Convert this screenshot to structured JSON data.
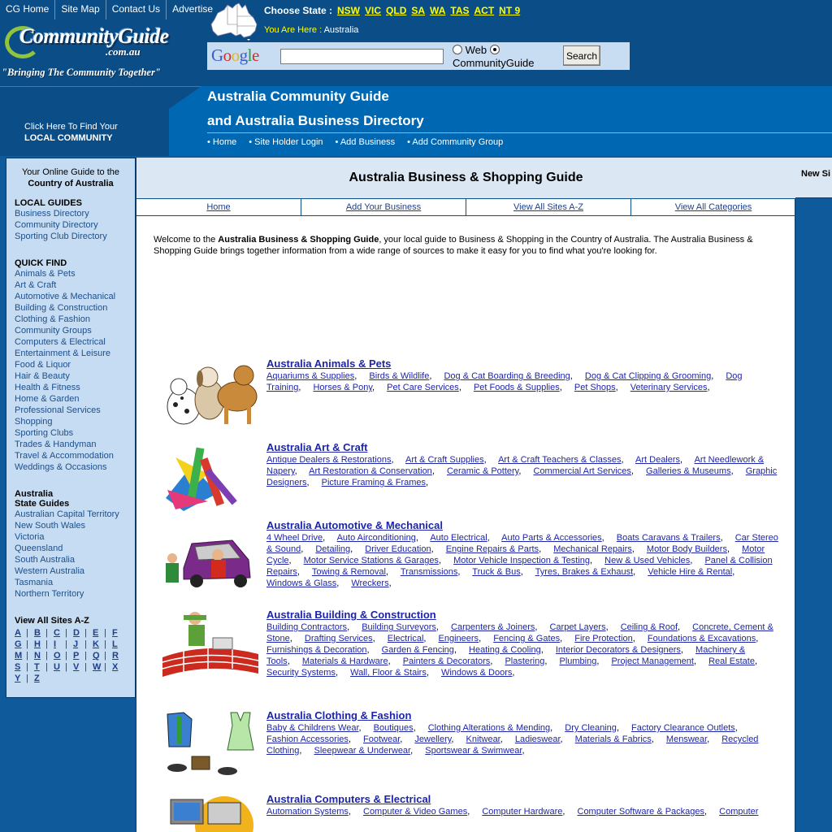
{
  "toplinks": [
    "CG Home",
    "Site Map",
    "Contact Us",
    "Advertise"
  ],
  "logo": {
    "line1": "CommunityGuide",
    "line2": ".com.au",
    "tagline": "\"Bringing The Community Together\""
  },
  "choose_state": {
    "label": "Choose State :",
    "states": [
      "NSW",
      "VIC",
      "QLD",
      "SA",
      "WA",
      "TAS",
      "ACT",
      "NT 9"
    ]
  },
  "you_are_here": {
    "label": "You Are Here :",
    "value": "Australia"
  },
  "search": {
    "logo": "Google",
    "query": "",
    "option_web": "Web",
    "option_site": "CommunityGuide",
    "button": "Search",
    "selected": "CommunityGuide"
  },
  "local_community": {
    "line1": "Click Here To Find Your",
    "line2": "LOCAL COMMUNITY"
  },
  "site_title": {
    "line1": "Australia Community Guide",
    "line2": "and Australia Business Directory"
  },
  "subnav": [
    "• Home",
    "• Site Holder Login",
    "• Add Business",
    "• Add Community Group"
  ],
  "sidebar": {
    "intro1": "Your Online Guide to the",
    "intro2": "Country of Australia",
    "local_guides_title": "LOCAL GUIDES",
    "local_guides": [
      "Business Directory",
      "Community Directory",
      "Sporting Club Directory"
    ],
    "quick_find_title": "QUICK FIND",
    "quick_find": [
      "Animals & Pets",
      "Art & Craft",
      "Automotive & Mechanical",
      "Building & Construction",
      "Clothing & Fashion",
      "Community Groups",
      "Computers & Electrical",
      "Entertainment & Leisure",
      "Food & Liquor",
      "Hair & Beauty",
      "Health & Fitness",
      "Home & Garden",
      "Professional Services",
      "Shopping",
      "Sporting Clubs",
      "Trades & Handyman",
      "Travel & Accommodation",
      "Weddings & Occasions"
    ],
    "state_guides_title1": "Australia",
    "state_guides_title2": "State Guides",
    "state_guides": [
      "Australian Capital Territory",
      "New South Wales",
      "Victoria",
      "Queensland",
      "South Australia",
      "Western Australia",
      "Tasmania",
      "Northern Territory"
    ],
    "az_title": "View All Sites A-Z",
    "az_rows": [
      [
        "A",
        "B",
        "C",
        "D",
        "E",
        "F"
      ],
      [
        "G",
        "H",
        "I",
        "J",
        "K",
        "L"
      ],
      [
        "M",
        "N",
        "O",
        "P",
        "Q",
        "R"
      ],
      [
        "S",
        "T",
        "U",
        "V",
        "W",
        "X"
      ],
      [
        "Y",
        "Z"
      ]
    ]
  },
  "main": {
    "heading": "Australia Business & Shopping Guide",
    "tabs": [
      "Home",
      "Add Your Business",
      "View All Sites A-Z",
      "View All Categories"
    ],
    "welcome_pre": "Welcome to the ",
    "welcome_bold": "Australia Business & Shopping Guide",
    "welcome_post": ", your local guide to Business & Shopping in the Country of Australia. The Australia Business & Shopping Guide brings together information from a wide range of sources to make it easy for you to find what you're looking for.",
    "categories": [
      {
        "title": "Australia Animals & Pets",
        "icon": "dogs-icon",
        "links": [
          "Aquariums & Supplies",
          "Birds & Wildlife",
          "Dog & Cat Boarding & Breeding",
          "Dog & Cat Clipping & Grooming",
          "Dog Training",
          "Horses & Pony",
          "Pet Care Services",
          "Pet Foods & Supplies",
          "Pet Shops",
          "Veterinary Services"
        ]
      },
      {
        "title": "Australia Art & Craft",
        "icon": "paint-tubes-icon",
        "links": [
          "Antique Dealers & Restorations",
          "Art & Craft Supplies",
          "Art & Craft Teachers & Classes",
          "Art Dealers",
          "Art Needlework & Napery",
          "Art Restoration & Conservation",
          "Ceramic & Pottery",
          "Commercial Art Services",
          "Galleries & Museums",
          "Graphic Designers",
          "Picture Framing & Frames"
        ]
      },
      {
        "title": "Australia Automotive & Mechanical",
        "icon": "mechanics-car-icon",
        "links": [
          "4 Wheel Drive",
          "Auto Airconditioning",
          "Auto Electrical",
          "Auto Parts & Accessories",
          "Boats Caravans & Trailers",
          "Car Stereo & Sound",
          "Detailing",
          "Driver Education",
          "Engine Repairs & Parts",
          "Mechanical Repairs",
          "Motor Body Builders",
          "Motor Cycle",
          "Motor Service Stations & Garages",
          "Motor Vehicle Inspection & Testing",
          "New & Used Vehicles",
          "Panel & Collision Repairs",
          "Towing & Removal",
          "Transmissions",
          "Truck & Bus",
          "Tyres, Brakes & Exhaust",
          "Vehicle Hire & Rental",
          "Windows & Glass",
          "Wreckers"
        ]
      },
      {
        "title": "Australia Building & Construction",
        "icon": "bricklayer-icon",
        "links": [
          "Building Contractors",
          "Building Surveyors",
          "Carpenters & Joiners",
          "Carpet Layers",
          "Ceiling & Roof",
          "Concrete, Cement & Stone",
          "Drafting Services",
          "Electrical",
          "Engineers",
          "Fencing & Gates",
          "Fire Protection",
          "Foundations & Excavations",
          "Furnishings & Decoration",
          "Garden & Fencing",
          "Heating & Cooling",
          "Interior Decorators & Designers",
          "Machinery & Tools",
          "Materials & Hardware",
          "Painters & Decorators",
          "Plastering",
          "Plumbing",
          "Project Management",
          "Real Estate",
          "Security Systems",
          "Wall, Floor & Stairs",
          "Windows & Doors"
        ]
      },
      {
        "title": "Australia Clothing & Fashion",
        "icon": "clothing-icon",
        "links": [
          "Baby & Childrens Wear",
          "Boutiques",
          "Clothing Alterations & Mending",
          "Dry Cleaning",
          "Factory Clearance Outlets",
          "Fashion Accessories",
          "Footwear",
          "Jewellery",
          "Knitwear",
          "Ladieswear",
          "Materials & Fabrics",
          "Menswear",
          "Recycled Clothing",
          "Sleepwear & Underwear",
          "Sportswear & Swimwear"
        ]
      },
      {
        "title": "Australia Computers & Electrical",
        "icon": "computer-icon",
        "links": [
          "Automation Systems",
          "Computer & Video Games",
          "Computer Hardware",
          "Computer Software & Packages",
          "Computer"
        ]
      }
    ]
  },
  "right": {
    "label": "New Si"
  }
}
